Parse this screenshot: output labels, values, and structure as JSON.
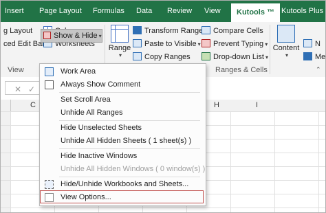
{
  "tabs": [
    "Insert",
    "Page Layout",
    "Formulas",
    "Data",
    "Review",
    "View",
    "Kutools ™",
    "Kutools Plus"
  ],
  "active_tab": "Kutools ™",
  "ribbon": {
    "view_group": {
      "paging_layout": "g Layout",
      "columns": "Columns",
      "edit_bar": "ced Edit Bar",
      "worksheets": "Worksheets",
      "show_hide": "Show & Hide",
      "label": "View"
    },
    "range_group": {
      "range": "Range",
      "transform_range": "Transform Range",
      "paste_to_visible": "Paste to Visible",
      "copy_ranges": "Copy Ranges",
      "compare_cells": "Compare Cells",
      "prevent_typing": "Prevent Typing",
      "dropdown_list": "Drop-down List",
      "label": "Ranges & Cells"
    },
    "content": "Content",
    "partial_n": "N",
    "partial_m": "Me"
  },
  "formula_bar": {
    "cancel": "✕",
    "enter": "✓"
  },
  "columns": [
    "C",
    "H",
    "I"
  ],
  "menu": {
    "items": [
      {
        "label": "Work Area",
        "disabled": false
      },
      {
        "label": "Always Show Comment",
        "disabled": false
      },
      {
        "label": "Set Scroll Area",
        "disabled": false
      },
      {
        "label": "Unhide All Ranges",
        "disabled": false
      },
      {
        "label": "Hide Unselected Sheets",
        "disabled": false
      },
      {
        "label": "Unhide All Hidden Sheets ( 1 sheet(s) )",
        "disabled": false
      },
      {
        "label": "Hide Inactive Windows",
        "disabled": false
      },
      {
        "label": "Unhide All Hidden Windows ( 0 window(s) )",
        "disabled": true
      },
      {
        "label": "Hide/Unhide Workbooks and Sheets...",
        "disabled": false
      },
      {
        "label": "View Options...",
        "disabled": false
      }
    ]
  },
  "colors": {
    "ribbon_green": "#217346",
    "highlight_border": "#c0504d"
  }
}
